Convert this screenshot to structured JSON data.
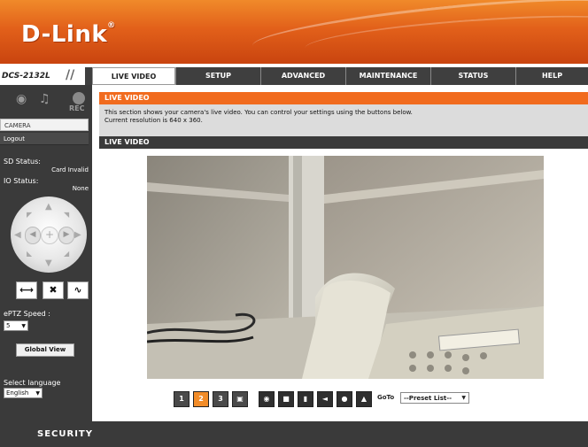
{
  "brand": {
    "logo": "D-Link",
    "reg": "®",
    "model": "DCS-2132L",
    "model_sep": "//"
  },
  "nav": {
    "tabs": [
      "LIVE VIDEO",
      "SETUP",
      "ADVANCED",
      "MAINTENANCE",
      "STATUS",
      "HELP"
    ],
    "active": "LIVE VIDEO"
  },
  "sidebar": {
    "rec_label": "REC",
    "camera_link": "CAMERA",
    "logout_link": "Logout",
    "sd_status_label": "SD Status:",
    "sd_status_value": "Card Invalid",
    "io_status_label": "IO Status:",
    "io_status_value": "None",
    "eptz_speed_label": "ePTZ Speed :",
    "eptz_speed_value": "5",
    "global_view_button": "Global View",
    "language_label": "Select language",
    "language_value": "English"
  },
  "main": {
    "section_title": "LIVE VIDEO",
    "description_line1": "This section shows your camera's live video. You can control your settings using the buttons below.",
    "description_line2": "Current resolution is 640 x 360.",
    "video_section_title": "LIVE VIDEO"
  },
  "toolbar": {
    "profile_buttons": [
      "1",
      "2",
      "3"
    ],
    "selected_profile": "2",
    "goto_label": "GoTo",
    "preset_placeholder": "--Preset List--"
  },
  "footer": {
    "label": "SECURITY"
  },
  "colors": {
    "orange": "#f16b1e",
    "dark": "#3a3a3a",
    "header": "#e2601a"
  }
}
